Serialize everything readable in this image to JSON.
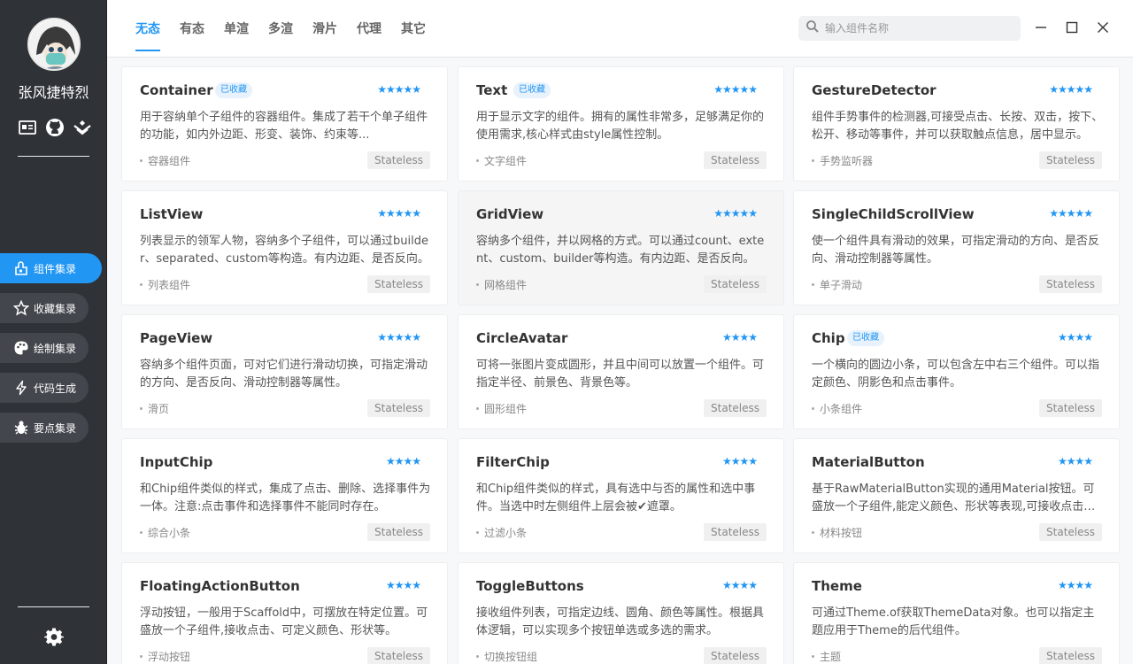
{
  "user": {
    "name": "张风捷特烈"
  },
  "social": [
    {
      "name": "profile-card-icon",
      "glyph": "▤"
    },
    {
      "name": "github-icon",
      "glyph": "◉"
    },
    {
      "name": "juejin-icon",
      "glyph": "⋎"
    }
  ],
  "nav": [
    {
      "label": "组件集录",
      "icon": "widgets-icon",
      "active": true
    },
    {
      "label": "收藏集录",
      "icon": "star-icon",
      "active": false
    },
    {
      "label": "绘制集录",
      "icon": "palette-icon",
      "active": false
    },
    {
      "label": "代码生成",
      "icon": "lightning-icon",
      "active": false
    },
    {
      "label": "要点集录",
      "icon": "bug-icon",
      "active": false
    }
  ],
  "tabs": [
    "无态",
    "有态",
    "单渲",
    "多渲",
    "滑片",
    "代理",
    "其它"
  ],
  "active_tab": 0,
  "search": {
    "placeholder": "输入组件名称"
  },
  "colors": {
    "accent": "#2196f3",
    "sidebar": "#2f3338"
  },
  "cards": [
    {
      "title": "Container",
      "fav": "已收藏",
      "stars": 5,
      "desc": "用于容纳单个子组件的容器组件。集成了若干个单子组件的功能，如内外边距、形变、装饰、约束等...",
      "tag": "容器组件",
      "state": "Stateless"
    },
    {
      "title": "Text",
      "fav": "已收藏",
      "stars": 5,
      "desc": "用于显示文字的组件。拥有的属性非常多，足够满足你的使用需求,核心样式由style属性控制。",
      "tag": "文字组件",
      "state": "Stateless"
    },
    {
      "title": "GestureDetector",
      "fav": "",
      "stars": 5,
      "desc": "组件手势事件的检测器,可接受点击、长按、双击，按下、松开、移动等事件，并可以获取触点信息，居中显示。",
      "tag": "手势监听器",
      "state": "Stateless"
    },
    {
      "title": "ListView",
      "fav": "",
      "stars": 5,
      "desc": "列表显示的领军人物，容纳多个子组件，可以通过builder、separated、custom等构造。有内边距、是否反向。",
      "tag": "列表组件",
      "state": "Stateless"
    },
    {
      "title": "GridView",
      "fav": "",
      "stars": 5,
      "desc": "容纳多个组件，并以网格的方式。可以通过count、extent、custom、builder等构造。有内边距、是否反向。",
      "tag": "网格组件",
      "state": "Stateless"
    },
    {
      "title": "SingleChildScrollView",
      "fav": "",
      "stars": 5,
      "desc": "使一个组件具有滑动的效果，可指定滑动的方向、是否反向、滑动控制器等属性。",
      "tag": "单子滑动",
      "state": "Stateless"
    },
    {
      "title": "PageView",
      "fav": "",
      "stars": 5,
      "desc": "容纳多个组件页面，可对它们进行滑动切换，可指定滑动的方向、是否反向、滑动控制器等属性。",
      "tag": "滑页",
      "state": "Stateless"
    },
    {
      "title": "CircleAvatar",
      "fav": "",
      "stars": 4,
      "desc": "可将一张图片变成圆形，并且中间可以放置一个组件。可指定半径、前景色、背景色等。",
      "tag": "圆形组件",
      "state": "Stateless"
    },
    {
      "title": "Chip",
      "fav": "已收藏",
      "stars": 4,
      "desc": "一个横向的圆边小条，可以包含左中右三个组件。可以指定颜色、阴影色和点击事件。",
      "tag": "小条组件",
      "state": "Stateless"
    },
    {
      "title": "InputChip",
      "fav": "",
      "stars": 4,
      "desc": "和Chip组件类似的样式，集成了点击、删除、选择事件为一体。注意:点击事件和选择事件不能同时存在。",
      "tag": "综合小条",
      "state": "Stateless"
    },
    {
      "title": "FilterChip",
      "fav": "",
      "stars": 4,
      "desc": "和Chip组件类似的样式，具有选中与否的属性和选中事件。当选中时左侧组件上层会被✔遮罩。",
      "tag": "过滤小条",
      "state": "Stateless"
    },
    {
      "title": "MaterialButton",
      "fav": "",
      "stars": 4,
      "desc": "基于RawMaterialButton实现的通用Material按钮。可盛放一个子组件,能定义颜色、形状等表现,可接收点击和长按事件。",
      "tag": "材料按钮",
      "state": "Stateless"
    },
    {
      "title": "FloatingActionButton",
      "fav": "",
      "stars": 4,
      "desc": "浮动按钮，一般用于Scaffold中，可摆放在特定位置。可盛放一个子组件,接收点击、可定义颜色、形状等。",
      "tag": "浮动按钮",
      "state": "Stateless"
    },
    {
      "title": "ToggleButtons",
      "fav": "",
      "stars": 4,
      "desc": "接收组件列表，可指定边线、圆角、颜色等属性。根据具体逻辑，可以实现多个按钮单选或多选的需求。",
      "tag": "切换按钮组",
      "state": "Stateless"
    },
    {
      "title": "Theme",
      "fav": "",
      "stars": 4,
      "desc": "可通过Theme.of获取ThemeData对象。也可以指定主题应用于Theme的后代组件。",
      "tag": "主题",
      "state": "Stateless"
    }
  ]
}
